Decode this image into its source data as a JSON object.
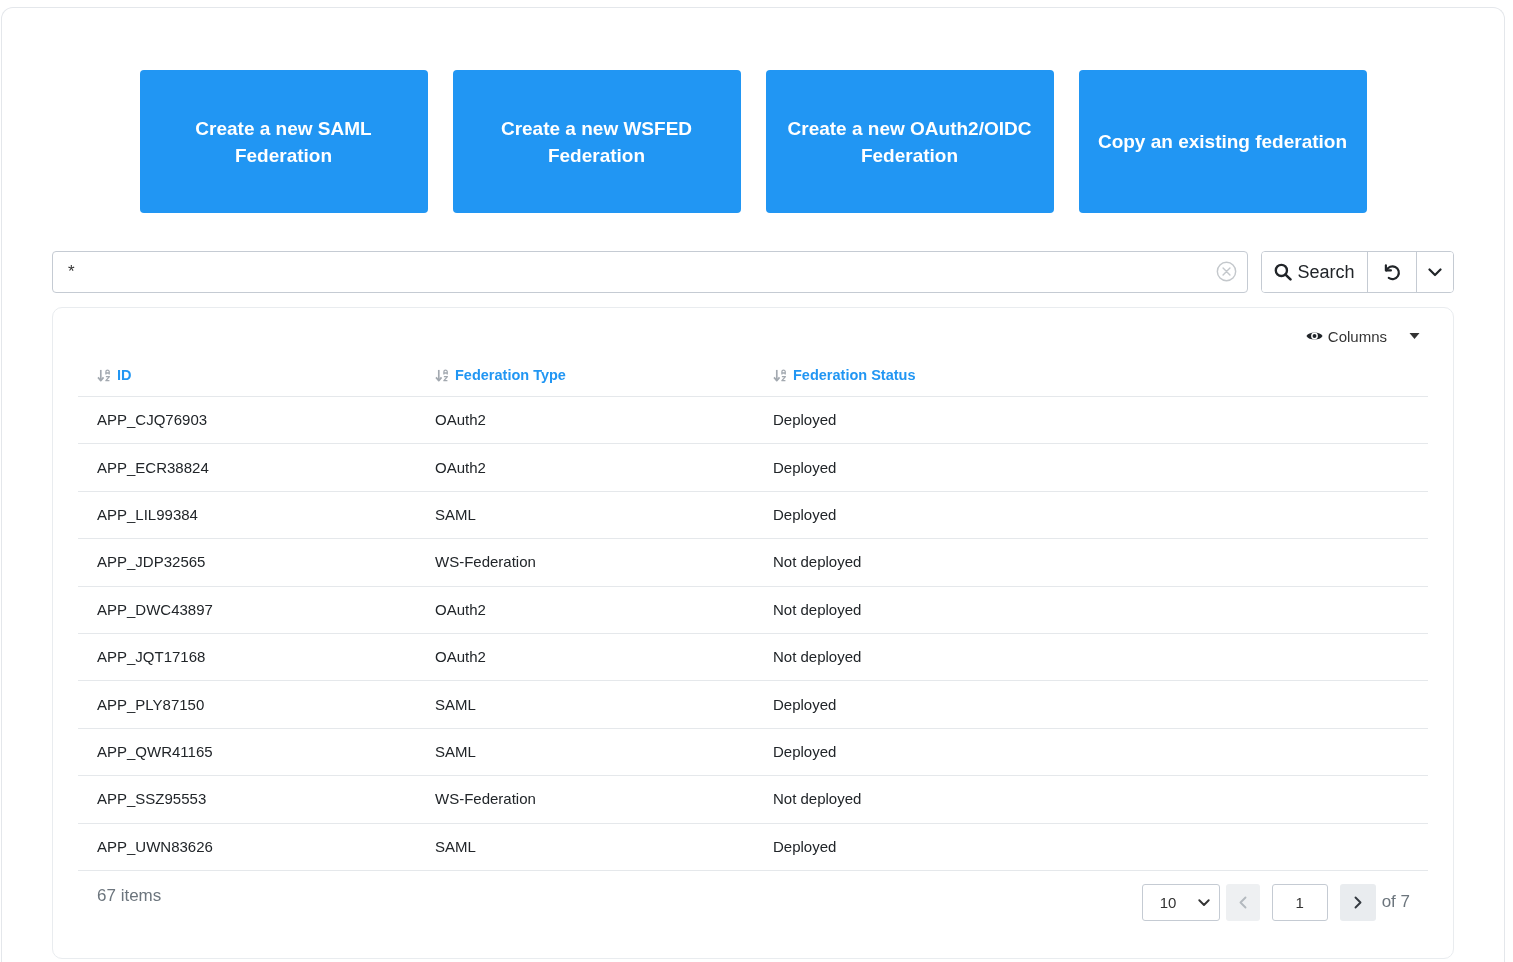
{
  "actions": [
    {
      "label": "Create a new SAML Federation"
    },
    {
      "label": "Create a new WSFED Federation"
    },
    {
      "label": "Create a new OAuth2/OIDC Federation"
    },
    {
      "label": "Copy an existing federation"
    }
  ],
  "search": {
    "value": "*",
    "button": "Search"
  },
  "table": {
    "columns_toggle": "Columns",
    "columns": [
      {
        "label": "ID"
      },
      {
        "label": "Federation Type"
      },
      {
        "label": "Federation Status"
      }
    ],
    "rows": [
      {
        "id": "APP_CJQ76903",
        "federation_type": "OAuth2",
        "federation_status": "Deployed"
      },
      {
        "id": "APP_ECR38824",
        "federation_type": "OAuth2",
        "federation_status": "Deployed"
      },
      {
        "id": "APP_LIL99384",
        "federation_type": "SAML",
        "federation_status": "Deployed"
      },
      {
        "id": "APP_JDP32565",
        "federation_type": "WS-Federation",
        "federation_status": "Not deployed"
      },
      {
        "id": "APP_DWC43897",
        "federation_type": "OAuth2",
        "federation_status": "Not deployed"
      },
      {
        "id": "APP_JQT17168",
        "federation_type": "OAuth2",
        "federation_status": "Not deployed"
      },
      {
        "id": "APP_PLY87150",
        "federation_type": "SAML",
        "federation_status": "Deployed"
      },
      {
        "id": "APP_QWR41165",
        "federation_type": "SAML",
        "federation_status": "Deployed"
      },
      {
        "id": "APP_SSZ95553",
        "federation_type": "WS-Federation",
        "federation_status": "Not deployed"
      },
      {
        "id": "APP_UWN83626",
        "federation_type": "SAML",
        "federation_status": "Deployed"
      }
    ]
  },
  "footer": {
    "count": "67 items",
    "page_size": "10",
    "page": "1",
    "total": "of 7",
    "prev": {
      "disabled": true
    },
    "next": {
      "disabled": false
    }
  }
}
